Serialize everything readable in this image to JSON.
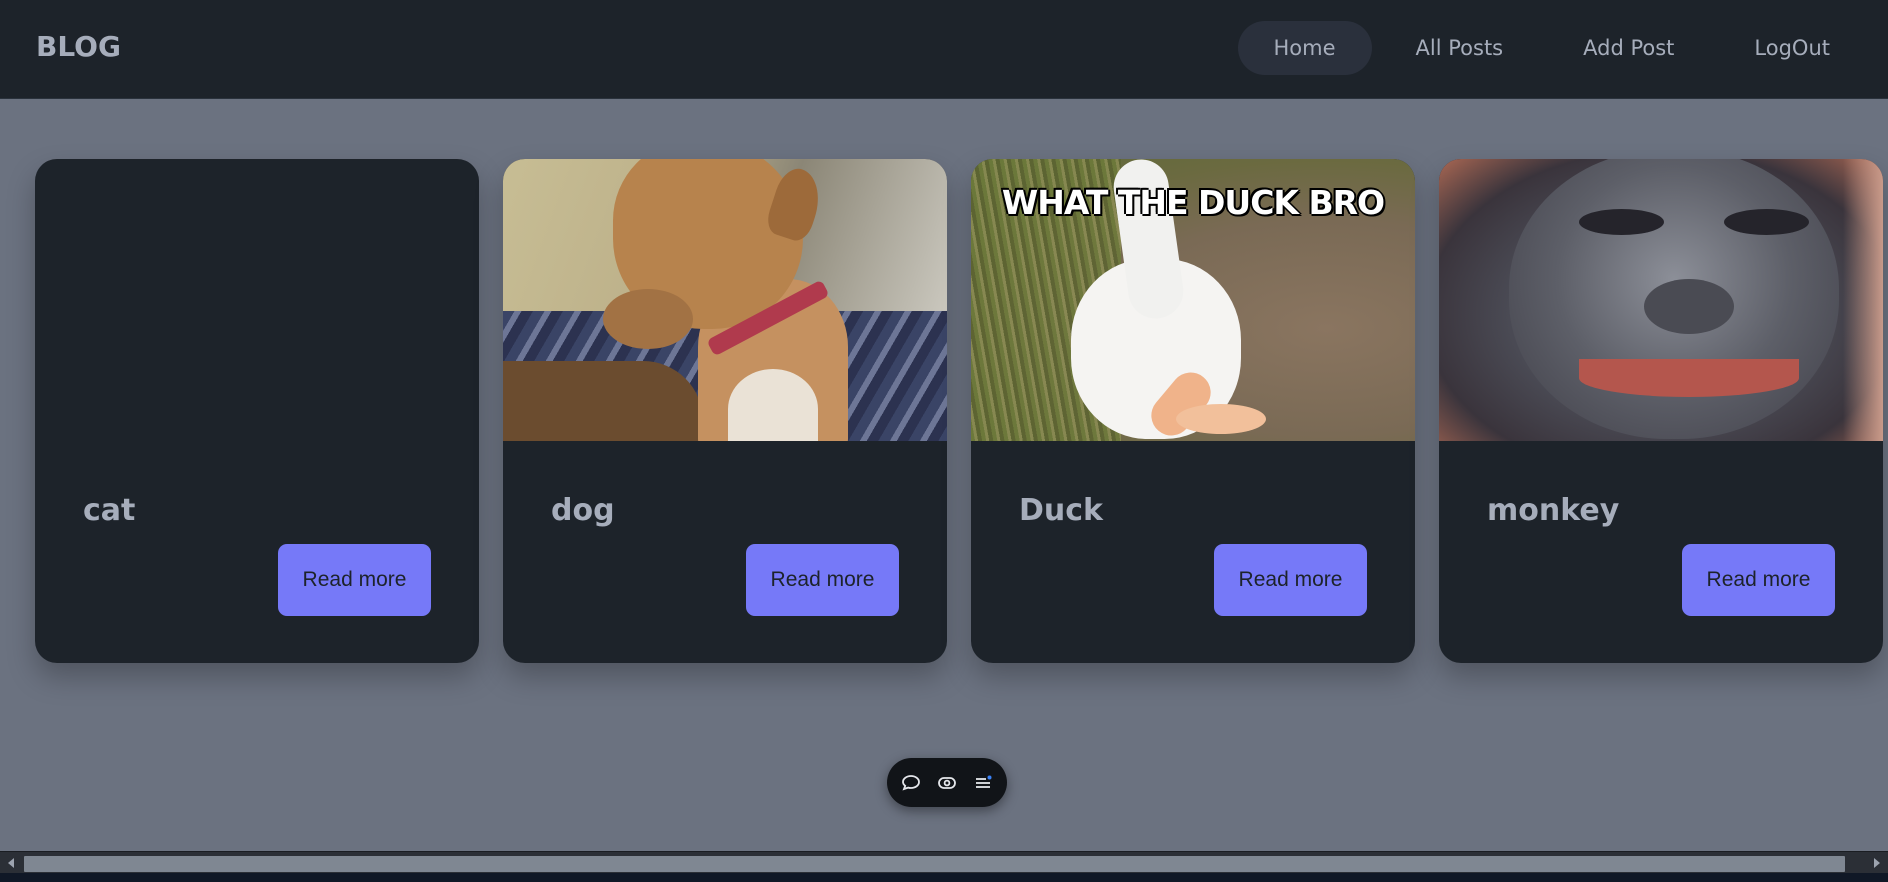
{
  "navbar": {
    "brand": "BLOG",
    "links": [
      {
        "label": "Home",
        "active": true
      },
      {
        "label": "All Posts",
        "active": false
      },
      {
        "label": "Add Post",
        "active": false
      },
      {
        "label": "LogOut",
        "active": false
      }
    ]
  },
  "cards": [
    {
      "title": "cat",
      "image": "none",
      "button": "Read more"
    },
    {
      "title": "dog",
      "image": "dog-photo",
      "button": "Read more"
    },
    {
      "title": "Duck",
      "image": "duck-meme-photo",
      "image_caption": "WHAT THE DUCK BRO",
      "button": "Read more"
    },
    {
      "title": "monkey",
      "image": "monkey-photo",
      "button": "Read more"
    }
  ],
  "floating_toolbar": {
    "icons": [
      "comment-icon",
      "eye-icon",
      "list-menu-icon"
    ]
  },
  "colors": {
    "page_background": "#6b7280",
    "navbar_background": "#1d232a",
    "card_background": "#1d232a",
    "text_muted": "#a6adbb",
    "button_primary": "#7679f8",
    "toolbar_background": "#111418"
  }
}
